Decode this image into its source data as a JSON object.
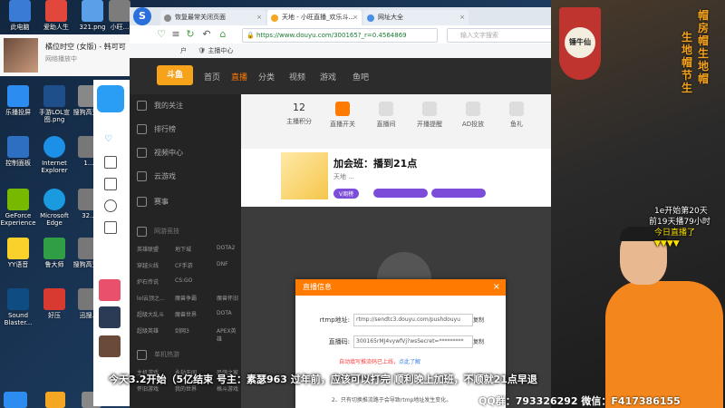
{
  "desktop": {
    "icons": [
      {
        "label": "此电脑",
        "color": "#3a7bd5"
      },
      {
        "label": "爱助人生",
        "color": "#e2473b"
      },
      {
        "label": "321.png",
        "color": "#5aa0e8"
      },
      {
        "label": "小旺...",
        "color": "#7c7c7c"
      },
      {
        "label": "乐播投屏",
        "color": "#2d8cf0"
      },
      {
        "label": "手游LOL宣图.png",
        "color": "#1f4f8a"
      },
      {
        "label": "搜狗高速...",
        "color": "#888888"
      },
      {
        "label": "控制面板",
        "color": "#2f6fc2"
      },
      {
        "label": "Internet Explorer",
        "color": "#1c8fe6"
      },
      {
        "label": "1...",
        "color": "#777777"
      },
      {
        "label": "GeForce Experience",
        "color": "#76b900"
      },
      {
        "label": "Microsoft Edge",
        "color": "#1a9be0"
      },
      {
        "label": "32...",
        "color": "#777777"
      },
      {
        "label": "YY语音",
        "color": "#f9d12a"
      },
      {
        "label": "鲁大师",
        "color": "#2f9e44"
      },
      {
        "label": "搜狗高速...",
        "color": "#777777"
      },
      {
        "label": "Sound Blaster...",
        "color": "#0f4c81"
      },
      {
        "label": "好压",
        "color": "#d93a2f"
      },
      {
        "label": "迅搜...",
        "color": "#777777"
      }
    ]
  },
  "music_widget": {
    "song": "橘位时空 (女版) - 韩可可",
    "status": "网络播放中"
  },
  "browser": {
    "tabs": [
      {
        "label": "恢复最常关闭页面",
        "active": false
      },
      {
        "label": "天地 - 小旺直播_欢乐斗...",
        "active": true
      },
      {
        "label": "网址大全",
        "active": false
      }
    ],
    "url": "https://www.douyu.com/300165?_r=0.4564869",
    "search_placeholder": "输入文字搜索",
    "bookmarks": [
      "主播中心"
    ],
    "bookmark_prefix": "户"
  },
  "douyu": {
    "logo": "斗鱼",
    "nav": [
      {
        "label": "首页",
        "active": false
      },
      {
        "label": "直播",
        "active": true
      },
      {
        "label": "分类",
        "active": false
      },
      {
        "label": "视频",
        "active": false
      },
      {
        "label": "游戏",
        "active": false
      },
      {
        "label": "鱼吧",
        "active": false
      }
    ],
    "sidebar": [
      {
        "label": "我的关注"
      },
      {
        "label": "排行榜"
      },
      {
        "label": "视频中心"
      },
      {
        "label": "云游戏"
      },
      {
        "label": "赛事"
      }
    ],
    "categories_title": "网游竞技",
    "categories": [
      "英雄联盟",
      "地下城",
      "DOTA2",
      "穿越火线",
      "CF手游",
      "DNF",
      "炉石传说",
      "CS:GO",
      "",
      "lol云顶之...",
      "魔兽争霸",
      "魔兽怀旧",
      "超级大乱斗",
      "魔兽世界",
      "DOTA",
      "超级英雄",
      "剑网3",
      "APEX英雄"
    ],
    "categories_title2": "单机热游",
    "categories2": [
      "主机游戏",
      "永劫无间",
      "恐鸽之家",
      "怀旧游戏",
      "我的世界",
      "格斗游戏"
    ],
    "toolbar": [
      {
        "label": "12",
        "sub": "主播积分"
      },
      {
        "label": "直播开关"
      },
      {
        "label": "直播间"
      },
      {
        "label": "开播提醒"
      },
      {
        "label": "AD投放"
      },
      {
        "label": "鱼礼"
      }
    ],
    "room_title": "加会班：播到21点",
    "room_sub": "天地 ...",
    "room_tag": "V周榜"
  },
  "dialog": {
    "title": "直播信息",
    "rtmp_label": "rtmp地址:",
    "rtmp_value": "rtmp://sendtc3.douyu.com/pushdouyu",
    "copy1": "复制",
    "code_label": "直播码:",
    "code_value": "300165rMJ4vywfVj?wsSecret=*********",
    "copy2": "复制",
    "warn": "自动填写推流码已上线，",
    "warn_link": "点此了解",
    "note1": "播码的有效期为5分钟。",
    "note2": "2、只有切换推流路于会导致rtmp地址发生变化。"
  },
  "stream_overlay": {
    "banner_text": "锤牛仙",
    "calligraphy": [
      "帽",
      "房",
      "帽",
      "生",
      "地",
      "帽",
      "生",
      "地",
      "帽",
      "节",
      "生"
    ],
    "right_text": [
      "1e开始第20天",
      "前19天播79小时",
      "今日直播了"
    ],
    "arrows": "▼▼▼▼",
    "marquee": "今天3.2开始（5亿结束 号主：素瑟963 过年前，应该可以打完  顺利晚上加班，不顺就21点早退",
    "contact": "QQ群：793326292    微信：F417386155"
  },
  "colors": {
    "accent": "#ff7a00",
    "overlay_yellow": "#ffe200",
    "url_green": "#1a7a2e"
  }
}
